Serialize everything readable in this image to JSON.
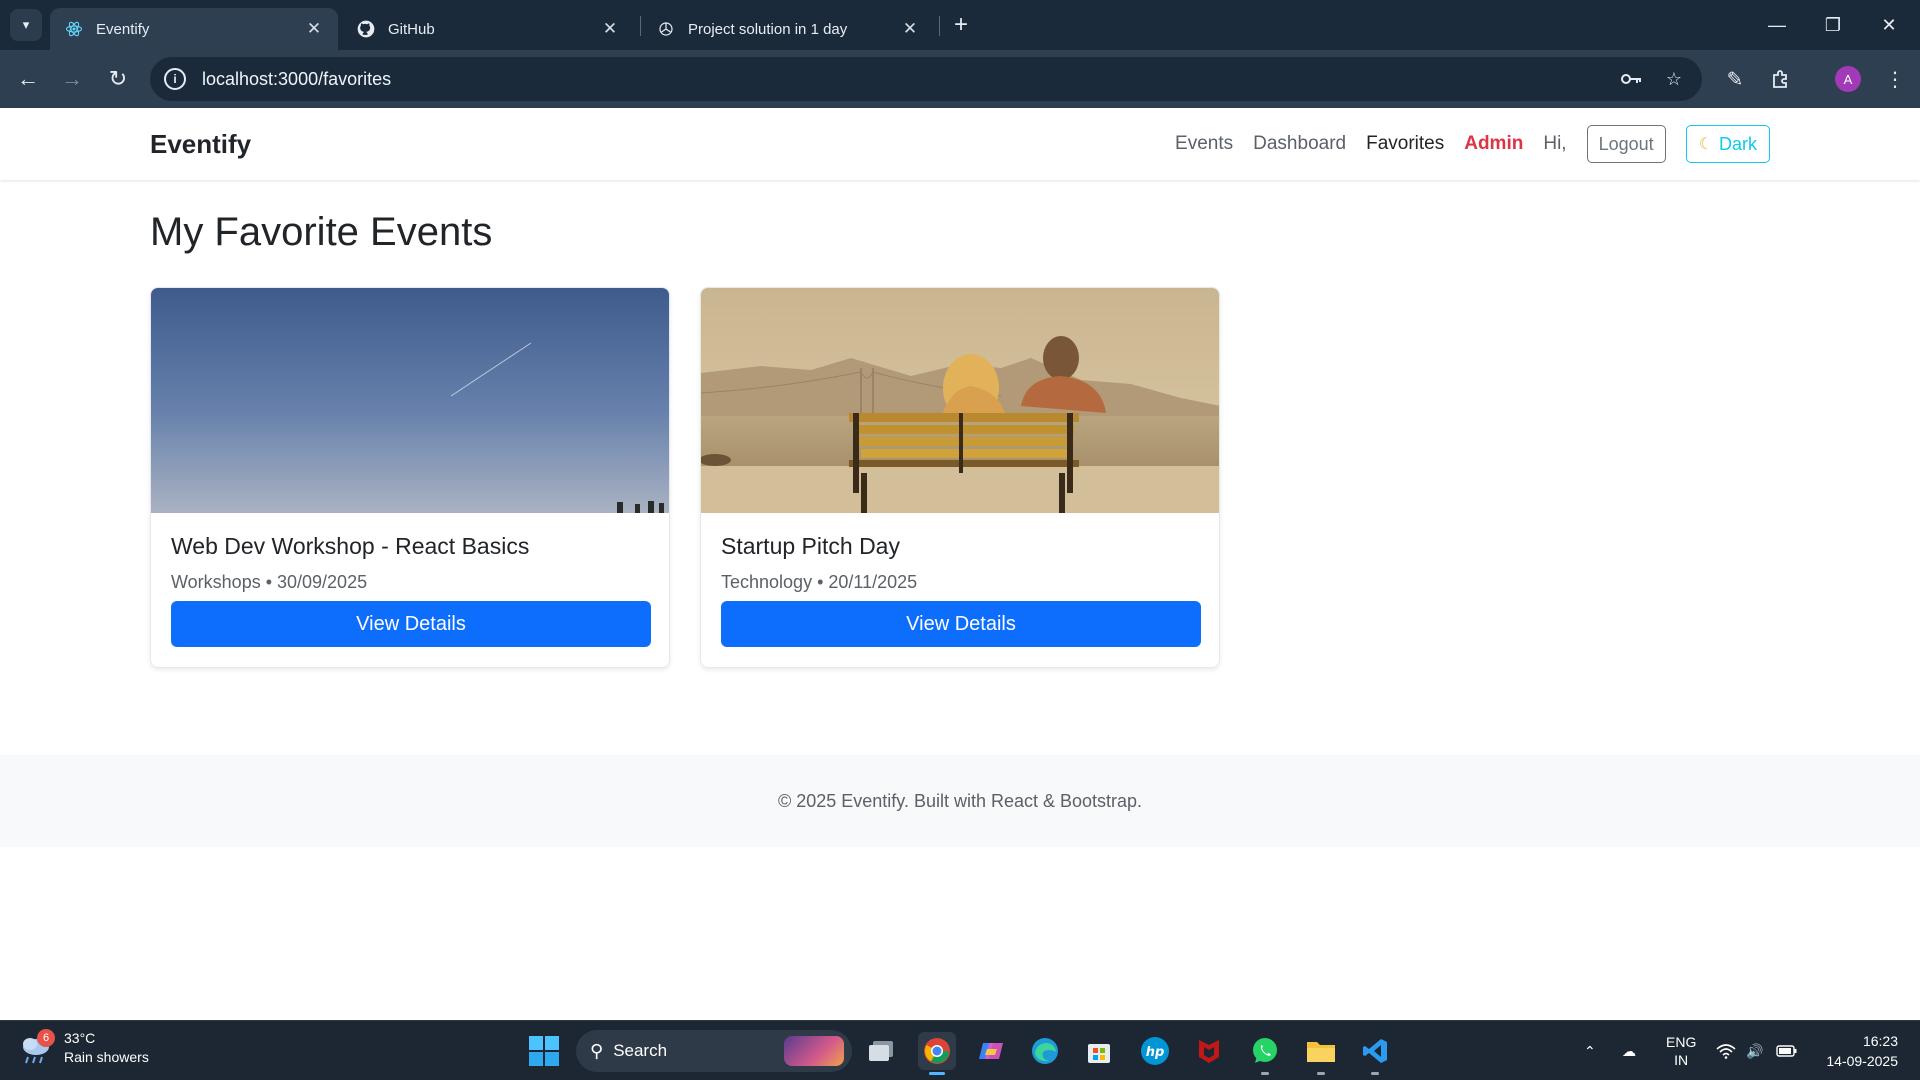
{
  "browser": {
    "tabs": [
      {
        "title": "Eventify",
        "icon": "react-icon",
        "active": true
      },
      {
        "title": "GitHub",
        "icon": "github-icon",
        "active": false
      },
      {
        "title": "Project solution in 1 day",
        "icon": "chatgpt-icon",
        "active": false
      }
    ],
    "url": "localhost:3000/favorites",
    "profile_initial": "A"
  },
  "navbar": {
    "brand": "Eventify",
    "links": [
      "Events",
      "Dashboard",
      "Favorites"
    ],
    "admin": "Admin",
    "greeting": "Hi,",
    "logout": "Logout",
    "theme_toggle": "Dark",
    "admin_color": "#dc3545"
  },
  "page": {
    "title": "My Favorite Events"
  },
  "events": [
    {
      "title": "Web Dev Workshop - React Basics",
      "meta": "Workshops • 30/09/2025",
      "button": "View Details"
    },
    {
      "title": "Startup Pitch Day",
      "meta": "Technology • 20/11/2025",
      "button": "View Details"
    }
  ],
  "footer": {
    "text": "© 2025 Eventify. Built with React & Bootstrap."
  },
  "taskbar": {
    "weather_badge": "6",
    "temperature": "33°C",
    "weather": "Rain showers",
    "search": "Search",
    "language": "ENG",
    "region": "IN",
    "time": "16:23",
    "date": "14-09-2025"
  },
  "colors": {
    "primary": "#0d6efd",
    "chrome_dark": "#1b2a3b",
    "chrome_toolbar": "#2f3f52"
  }
}
